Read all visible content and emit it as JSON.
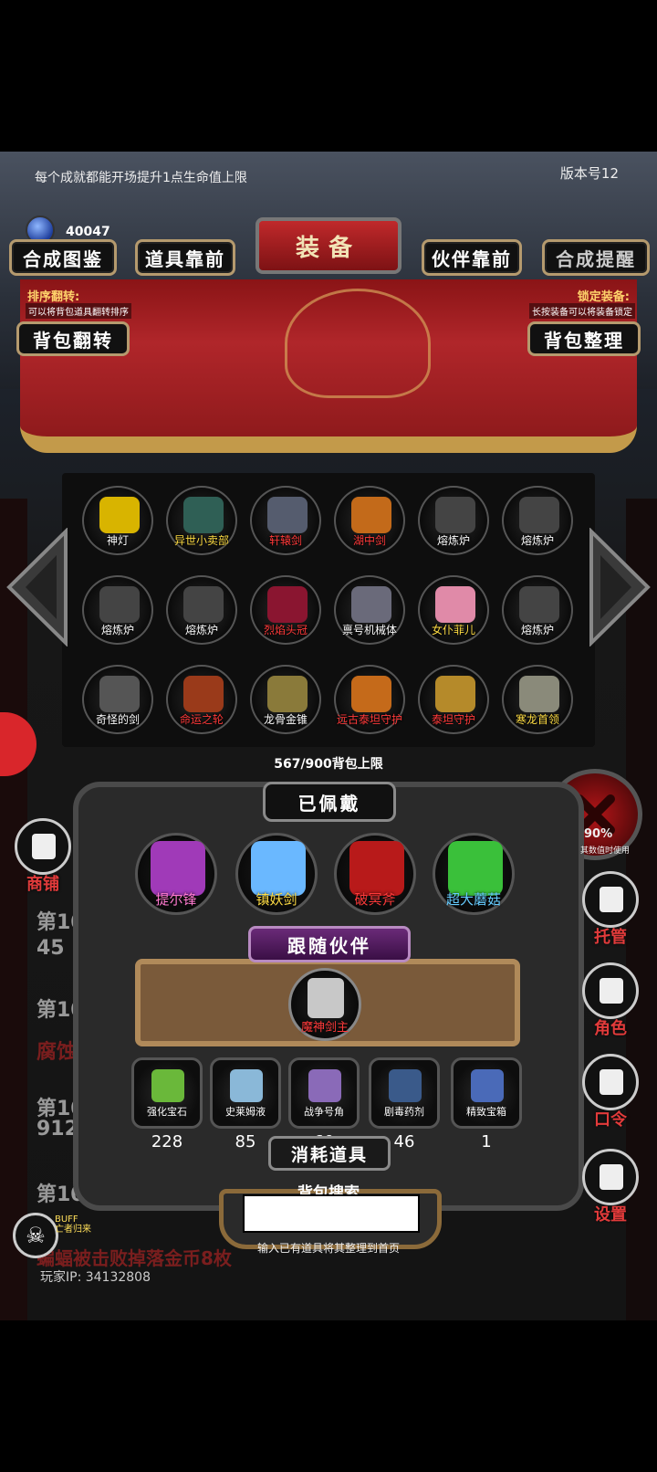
{
  "header": {
    "hint": "每个成就都能开场提升1点生命值上限",
    "version": "版本号12",
    "currency": "40047"
  },
  "tabs": {
    "recipes": "合成图鉴",
    "items_front": "道具靠前",
    "title": "装备",
    "partner_front": "伙伴靠前",
    "craft_remind": "合成提醒"
  },
  "sort": {
    "label": "排序翻转:",
    "desc": "可以将背包道具翻转排序",
    "button": "背包翻转"
  },
  "lock": {
    "label": "锁定装备:",
    "desc": "长按装备可以将装备锁定",
    "button": "背包整理"
  },
  "bag_items": [
    {
      "name": "神灯",
      "color": "white",
      "icon": "lamp-icon",
      "hex": "#d8b400"
    },
    {
      "name": "异世小卖部",
      "color": "yellow",
      "icon": "shop-icon",
      "hex": "#2f5f55"
    },
    {
      "name": "轩辕剑",
      "color": "red",
      "icon": "sword-icon",
      "hex": "#555c6e"
    },
    {
      "name": "湖中剑",
      "color": "red",
      "icon": "sword-icon",
      "hex": "#c36a1a"
    },
    {
      "name": "熔炼炉",
      "color": "white",
      "icon": "furnace-icon",
      "hex": "#444"
    },
    {
      "name": "熔炼炉",
      "color": "white",
      "icon": "furnace-icon",
      "hex": "#444"
    },
    {
      "name": "熔炼炉",
      "color": "white",
      "icon": "furnace-icon",
      "hex": "#444"
    },
    {
      "name": "熔炼炉",
      "color": "white",
      "icon": "furnace-icon",
      "hex": "#444"
    },
    {
      "name": "烈焰头冠",
      "color": "red",
      "icon": "crown-icon",
      "hex": "#8a1530"
    },
    {
      "name": "禀号机械体",
      "color": "white",
      "icon": "robot-icon",
      "hex": "#6a6a7a"
    },
    {
      "name": "女仆菲儿",
      "color": "yellow",
      "icon": "maid-icon",
      "hex": "#e08aa8"
    },
    {
      "name": "熔炼炉",
      "color": "white",
      "icon": "furnace-icon",
      "hex": "#444"
    },
    {
      "name": "奇怪的剑",
      "color": "white",
      "icon": "sword-icon",
      "hex": "#555"
    },
    {
      "name": "命运之轮",
      "color": "red",
      "icon": "wheel-icon",
      "hex": "#9a3a1a"
    },
    {
      "name": "龙骨金锥",
      "color": "white",
      "icon": "scepter-icon",
      "hex": "#8a7a3a"
    },
    {
      "name": "远古泰坦守护",
      "color": "red",
      "icon": "titan-icon",
      "hex": "#c56a1a"
    },
    {
      "name": "泰坦守护",
      "color": "red",
      "icon": "titan-icon",
      "hex": "#b58a2a"
    },
    {
      "name": "寒龙首领",
      "color": "yellow",
      "icon": "dragon-icon",
      "hex": "#8a8a7a"
    }
  ],
  "capacity": "567/900背包上限",
  "worn": {
    "title": "已佩戴",
    "items": [
      {
        "name": "提尔锋",
        "color": "#ff7ad0",
        "hex": "#a03ab8"
      },
      {
        "name": "镇妖剑",
        "color": "#ffdd44",
        "hex": "#6ab8ff"
      },
      {
        "name": "破冥斧",
        "color": "#ff3a3a",
        "hex": "#b81a1a"
      },
      {
        "name": "超大蘑菇",
        "color": "#66ccff",
        "hex": "#3ac03a"
      }
    ]
  },
  "partner": {
    "title": "跟随伙伴",
    "name": "魔神剑主"
  },
  "consumables": {
    "title": "消耗道具",
    "items": [
      {
        "name": "强化宝石",
        "count": "228",
        "hex": "#6ab83a"
      },
      {
        "name": "史莱姆液",
        "count": "85",
        "hex": "#8ab8d8"
      },
      {
        "name": "战争号角",
        "count": "60",
        "hex": "#8a6ab8"
      },
      {
        "name": "剧毒药剂",
        "count": "46",
        "hex": "#3a5a8a"
      },
      {
        "name": "精致宝箱",
        "count": "1",
        "hex": "#4a6ab8"
      }
    ]
  },
  "search": {
    "label": "背包搜索",
    "value": "",
    "hint": "输入已有道具将其整理到首页"
  },
  "left_menu": {
    "shop": "商铺"
  },
  "right_menu": {
    "percent": "90%",
    "percent_sub": "其数值时使用",
    "manage": "托管",
    "role": "角色",
    "code": "口令",
    "settings": "设置"
  },
  "log": {
    "l1": "第10",
    "l2": "45",
    "l3": "第10",
    "l4": "腐蚀",
    "l5": "第10",
    "l6": "912",
    "l7": "第101278回:发现游荡的宝",
    "l8": "蝙蝠被击败掉落金币8枚"
  },
  "buff": {
    "label": "BUFF",
    "sub": "亡者归来"
  },
  "player_ip": "玩家IP:  34132808"
}
